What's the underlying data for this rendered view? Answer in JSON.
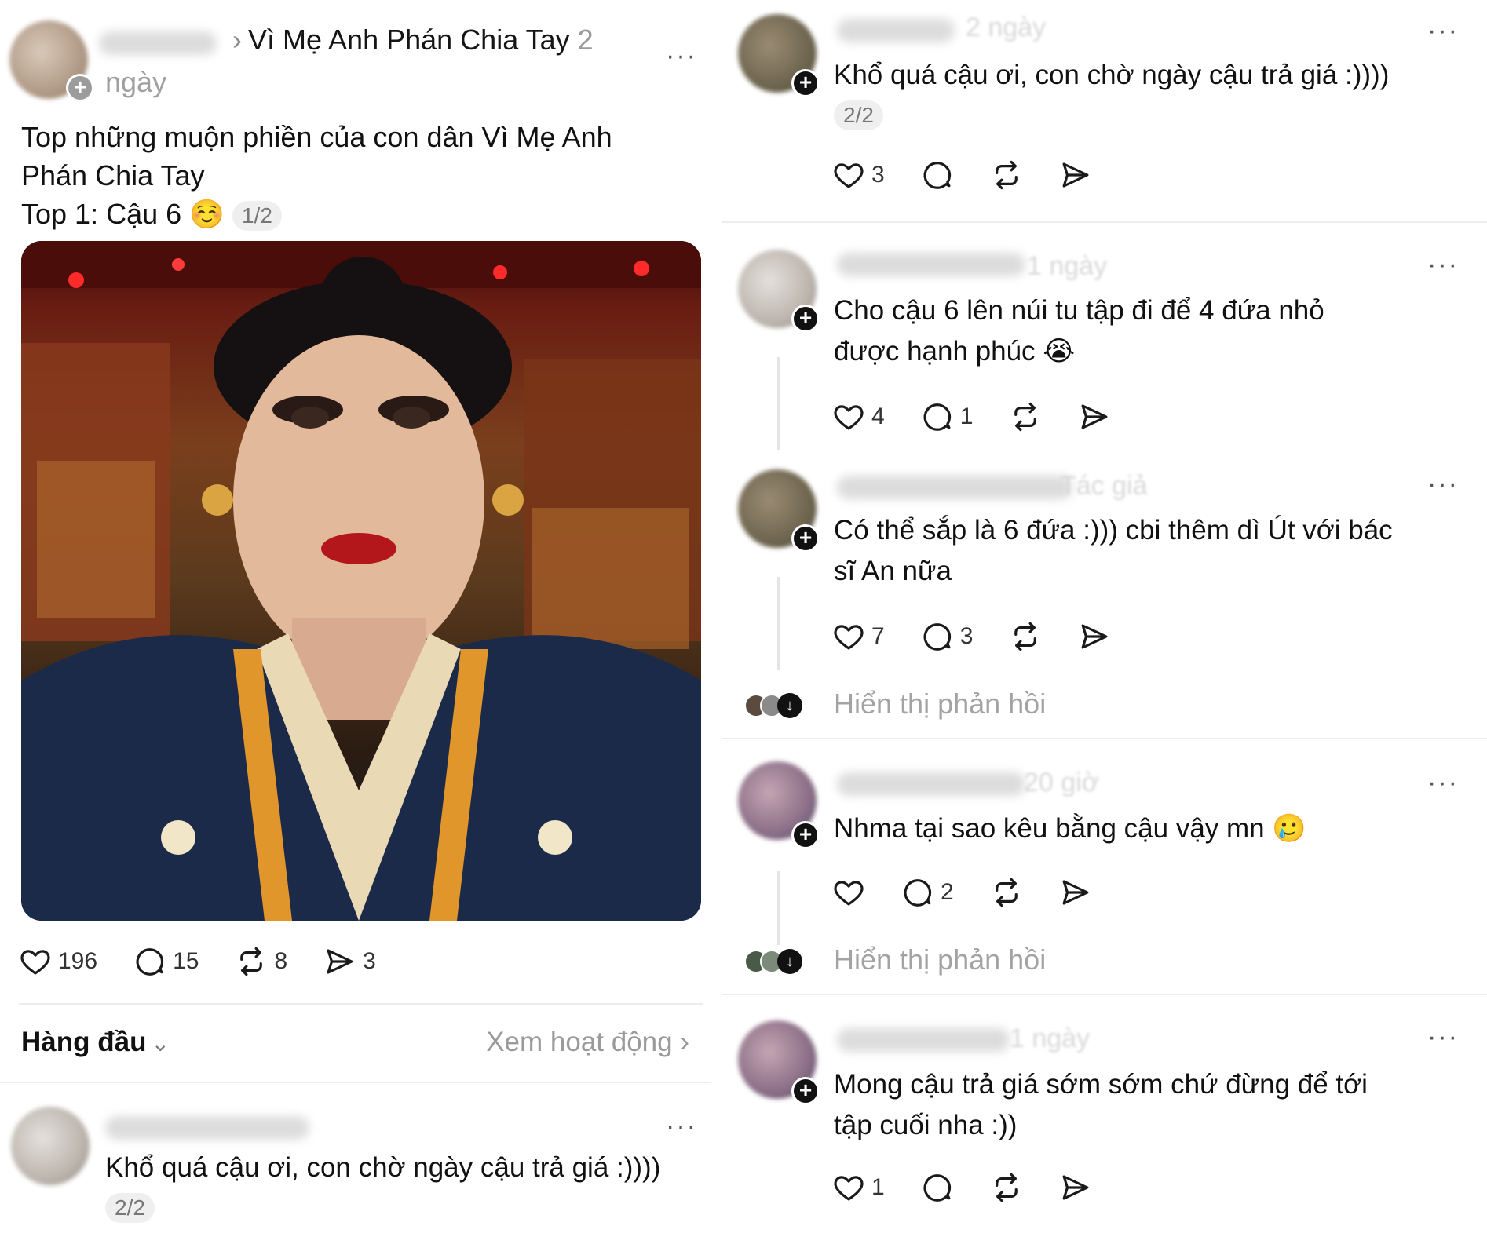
{
  "post": {
    "breadcrumb_topic": "Vì Mẹ Anh Phán Chia Tay",
    "breadcrumb_time": "2",
    "time_unit": "ngày",
    "text_line1": "Top những muộn phiền của con dân Vì Mẹ Anh",
    "text_line2": "Phán Chia Tay",
    "text_line3": "Top 1: Cậu 6 ☺️",
    "page_indicator": "1/2",
    "likes": "196",
    "replies": "15",
    "reposts": "8",
    "shares": "3",
    "more": "···"
  },
  "sort": {
    "label": "Hàng đầu",
    "activity": "Xem hoạt động"
  },
  "left_reply": {
    "text": "Khổ quá cậu ơi, con chờ ngày cậu trả giá :))))",
    "page_indicator": "2/2",
    "more": "···"
  },
  "right_col": {
    "thread_top": {
      "meta": "2 ngày",
      "text": "Khổ quá cậu ơi, con chờ ngày cậu trả giá :))))",
      "page_indicator": "2/2",
      "likes": "3",
      "more": "···"
    },
    "comments": [
      {
        "meta": "1 ngày",
        "line1": "Cho cậu 6 lên núi tu tập đi để 4 đứa nhỏ",
        "line2": "được hạnh phúc 😭",
        "likes": "4",
        "replies": "1",
        "more": "···"
      },
      {
        "meta": "Tác giả",
        "line1": "Có thể sắp là 6 đứa :))) cbi thêm dì Út với bác",
        "line2": "sĩ An nữa",
        "likes": "7",
        "replies": "3",
        "more": "···",
        "show_replies": "Hiển thị phản hồi"
      },
      {
        "meta": "20 giờ",
        "line1": "Nhma tại sao kêu bằng cậu vậy mn 🥲",
        "likes": "",
        "replies": "2",
        "more": "···",
        "show_replies": "Hiển thị phản hồi"
      },
      {
        "meta": "1 ngày",
        "line1": "Mong cậu trả giá sớm sớm chứ đừng để tới",
        "line2": "tập cuối nha :))",
        "likes": "1",
        "replies": "",
        "more": "···"
      }
    ]
  },
  "icons": [
    "heart-icon",
    "comment-icon",
    "repost-icon",
    "share-icon",
    "plus-icon",
    "chevron-right-icon",
    "chevron-down-icon",
    "more-icon"
  ]
}
